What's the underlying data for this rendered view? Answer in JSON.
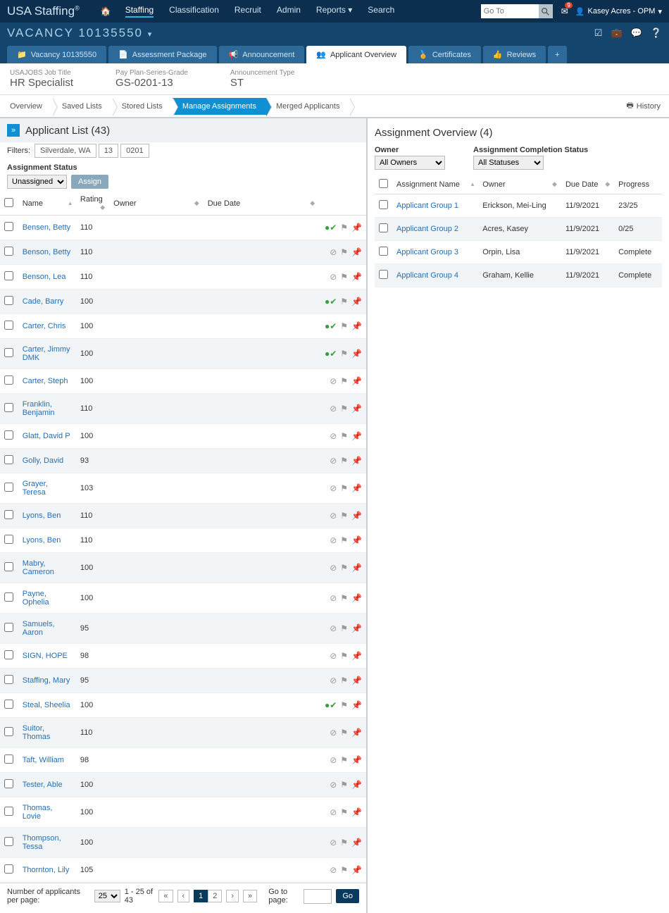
{
  "brand": "USA Staffing",
  "nav": [
    "Staffing",
    "Classification",
    "Recruit",
    "Admin",
    "Reports",
    "Search"
  ],
  "nav_active": 0,
  "goto_placeholder": "Go To",
  "mail_badge": "9",
  "user": "Kasey Acres - OPM",
  "vacancy_title": "VACANCY 10135550",
  "tabs": [
    {
      "label": "Vacancy 10135550"
    },
    {
      "label": "Assessment Package"
    },
    {
      "label": "Announcement"
    },
    {
      "label": "Applicant Overview",
      "active": true
    },
    {
      "label": "Certificates"
    },
    {
      "label": "Reviews"
    }
  ],
  "jobhdr": [
    {
      "lbl": "USAJOBS Job Title",
      "val": "HR Specialist"
    },
    {
      "lbl": "Pay Plan-Series-Grade",
      "val": "GS-0201-13"
    },
    {
      "lbl": "Announcement Type",
      "val": "ST"
    }
  ],
  "subtabs": [
    "Overview",
    "Saved Lists",
    "Stored Lists",
    "Manage Assignments",
    "Merged Applicants"
  ],
  "subtab_active": 3,
  "history": "History",
  "applicant_list_title": "Applicant List (43)",
  "filters_label": "Filters:",
  "filter_tags": [
    "Silverdale, WA",
    "13",
    "0201"
  ],
  "assign_status_label": "Assignment Status",
  "assign_select": "Unassigned",
  "assign_btn": "Assign",
  "col_hdrs": {
    "name": "Name",
    "rating": "Rating",
    "owner": "Owner",
    "due": "Due Date"
  },
  "applicants": [
    {
      "name": "Bensen, Betty",
      "rating": "110",
      "status": "ok"
    },
    {
      "name": "Benson, Betty",
      "rating": "110",
      "status": "norm"
    },
    {
      "name": "Benson, Lea",
      "rating": "110",
      "status": "norm"
    },
    {
      "name": "Cade, Barry",
      "rating": "100",
      "status": "ok"
    },
    {
      "name": "Carter, Chris",
      "rating": "100",
      "status": "ok"
    },
    {
      "name": "Carter, Jimmy DMK",
      "rating": "100",
      "status": "ok",
      "flag": "orange"
    },
    {
      "name": "Carter, Steph",
      "rating": "100",
      "status": "norm"
    },
    {
      "name": "Franklin, Benjamin",
      "rating": "110",
      "status": "norm"
    },
    {
      "name": "Glatt, David P",
      "rating": "100",
      "status": "norm"
    },
    {
      "name": "Golly, David",
      "rating": "93",
      "status": "norm"
    },
    {
      "name": "Grayer, Teresa",
      "rating": "103",
      "status": "norm"
    },
    {
      "name": "Lyons, Ben",
      "rating": "110",
      "status": "norm"
    },
    {
      "name": "Lyons, Ben",
      "rating": "110",
      "status": "norm"
    },
    {
      "name": "Mabry, Cameron",
      "rating": "100",
      "status": "norm"
    },
    {
      "name": "Payne, Ophelia",
      "rating": "100",
      "status": "norm"
    },
    {
      "name": "Samuels, Aaron",
      "rating": "95",
      "status": "norm"
    },
    {
      "name": "SIGN, HOPE",
      "rating": "98",
      "status": "norm"
    },
    {
      "name": "Staffing, Mary",
      "rating": "95",
      "status": "norm"
    },
    {
      "name": "Steal, Sheelia",
      "rating": "100",
      "status": "ok"
    },
    {
      "name": "Suitor, Thomas",
      "rating": "110",
      "status": "norm"
    },
    {
      "name": "Taft, William",
      "rating": "98",
      "status": "norm"
    },
    {
      "name": "Tester, Able",
      "rating": "100",
      "status": "norm"
    },
    {
      "name": "Thomas, Lovie",
      "rating": "100",
      "status": "norm"
    },
    {
      "name": "Thompson, Tessa",
      "rating": "100",
      "status": "norm"
    },
    {
      "name": "Thornton, Lily",
      "rating": "105",
      "status": "norm"
    }
  ],
  "pager": {
    "perpage_lbl": "Number of applicants per page:",
    "perpage": "25",
    "range": "1 - 25 of 43",
    "pages": [
      "1",
      "2"
    ],
    "goto_lbl": "Go to page:",
    "go": "Go"
  },
  "overview_title": "Assignment Overview (4)",
  "owner_lbl": "Owner",
  "owner_sel": "All Owners",
  "compstat_lbl": "Assignment Completion Status",
  "compstat_sel": "All Statuses",
  "rcol_hdrs": {
    "name": "Assignment Name",
    "owner": "Owner",
    "due": "Due Date",
    "progress": "Progress"
  },
  "assignments": [
    {
      "name": "Applicant Group 1",
      "owner": "Erickson, Mei-Ling",
      "due": "11/9/2021",
      "progress": "23/25"
    },
    {
      "name": "Applicant Group 2",
      "owner": "Acres, Kasey",
      "due": "11/9/2021",
      "progress": "0/25"
    },
    {
      "name": "Applicant Group 3",
      "owner": "Orpin, Lisa",
      "due": "11/9/2021",
      "progress": "Complete"
    },
    {
      "name": "Applicant Group 4",
      "owner": "Graham, Kellie",
      "due": "11/9/2021",
      "progress": "Complete"
    }
  ]
}
